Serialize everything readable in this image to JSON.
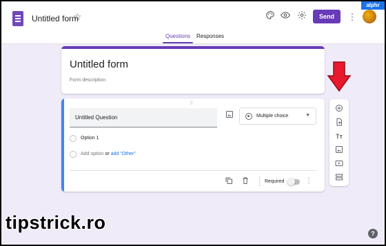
{
  "header": {
    "form_title": "Untitled form",
    "star_icon": "star-outline-icon",
    "palette_icon": "palette-icon",
    "preview_icon": "eye-icon",
    "settings_icon": "gear-icon",
    "send_label": "Send",
    "more_icon": "more-vertical-icon",
    "brand_badge": "alphr"
  },
  "tabs": [
    {
      "label": "Questions",
      "active": true
    },
    {
      "label": "Responses",
      "active": false
    }
  ],
  "title_card": {
    "title": "Untitled form",
    "description_placeholder": "Form description"
  },
  "question_card": {
    "drag_handle": "⠿",
    "question_text": "Untitled Question",
    "type_label": "Multiple choice",
    "options": [
      {
        "label": "Option 1"
      }
    ],
    "add_option": {
      "label": "Add option",
      "or": "or",
      "other_link": "add \"Other\""
    },
    "required_label": "Required",
    "required_on": false
  },
  "side_toolbar": {
    "items": [
      {
        "name": "add-question-icon"
      },
      {
        "name": "import-questions-icon"
      },
      {
        "name": "add-title-icon"
      },
      {
        "name": "add-image-icon"
      },
      {
        "name": "add-video-icon"
      },
      {
        "name": "add-section-icon"
      }
    ]
  },
  "watermark": "tipstrick.ro",
  "colors": {
    "accent": "#673ab7",
    "background": "#f0ebf8",
    "question_bar": "#4285f4",
    "arrow": "#e8192c"
  }
}
